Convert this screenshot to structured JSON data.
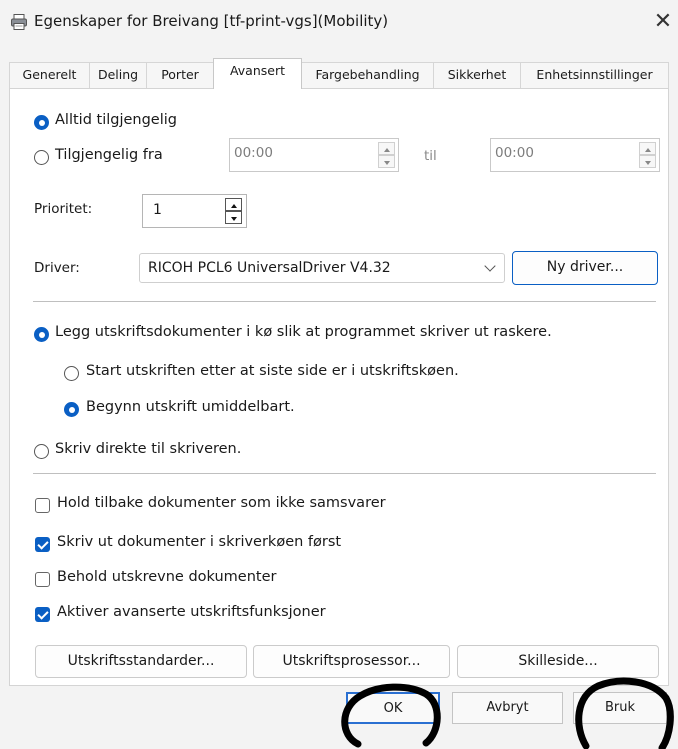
{
  "window": {
    "title": "Egenskaper for Breivang [tf-print-vgs](Mobility)",
    "close_glyph": "✕",
    "title_icon": "printer-icon"
  },
  "tabs": [
    {
      "label": "Generelt",
      "active": false
    },
    {
      "label": "Deling",
      "active": false
    },
    {
      "label": "Porter",
      "active": false
    },
    {
      "label": "Avansert",
      "active": true
    },
    {
      "label": "Fargebehandling",
      "active": false
    },
    {
      "label": "Sikkerhet",
      "active": false
    },
    {
      "label": "Enhetsinnstillinger",
      "active": false
    }
  ],
  "availability": {
    "always_label": "Alltid tilgjengelig",
    "always_selected": true,
    "from_label": "Tilgjengelig fra",
    "from_value": "00:00",
    "to_label": "til",
    "to_value": "00:00"
  },
  "priority": {
    "label": "Prioritet:",
    "value": "1"
  },
  "driver": {
    "label": "Driver:",
    "value": "RICOH PCL6 UniversalDriver V4.32",
    "new_button": "Ny driver..."
  },
  "spool": {
    "queue_label": "Legg utskriftsdokumenter i kø slik at programmet skriver ut raskere.",
    "queue_selected": true,
    "after_last_page_label": "Start utskriften etter at siste side er i utskriftskøen.",
    "after_last_page_selected": false,
    "immediately_label": "Begynn utskrift umiddelbart.",
    "immediately_selected": true,
    "direct_label": "Skriv direkte til skriveren.",
    "direct_selected": false
  },
  "options": [
    {
      "label": "Hold tilbake dokumenter som ikke samsvarer",
      "checked": false
    },
    {
      "label": "Skriv ut dokumenter i skriverkøen først",
      "checked": true
    },
    {
      "label": "Behold utskrevne dokumenter",
      "checked": false
    },
    {
      "label": "Aktiver avanserte utskriftsfunksjoner",
      "checked": true
    }
  ],
  "bottom_buttons": {
    "defaults": "Utskriftsstandarder...",
    "processor": "Utskriftsprosessor...",
    "separator_page": "Skilleside..."
  },
  "dialog_buttons": {
    "ok": "OK",
    "cancel": "Avbryt",
    "apply": "Bruk"
  },
  "colors": {
    "accent": "#0a5fc4",
    "scribble": "#000000"
  }
}
